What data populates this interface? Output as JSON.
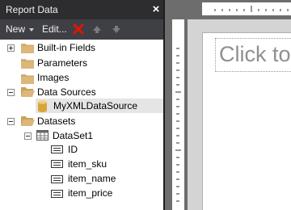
{
  "panel": {
    "title": "Report Data",
    "close_glyph": "×"
  },
  "toolbar": {
    "new_label": "New",
    "edit_label": "Edit...",
    "icons": [
      "chevron-down-icon",
      "delete-icon",
      "move-up-icon",
      "move-down-icon"
    ]
  },
  "tree": {
    "builtin_fields": "Built-in Fields",
    "parameters": "Parameters",
    "images": "Images",
    "data_sources": "Data Sources",
    "data_source_item": "MyXMLDataSource",
    "datasets": "Datasets",
    "dataset_item": "DataSet1",
    "fields": [
      "ID",
      "item_sku",
      "item_name",
      "item_price"
    ]
  },
  "design": {
    "title_placeholder": "Click to add title"
  },
  "colors": {
    "title_bar": "#2d2d30",
    "toolbar": "#3f3f46",
    "folder": "#dcb67a",
    "delete_red": "#e51400",
    "design_background": "#6d6d6d"
  }
}
